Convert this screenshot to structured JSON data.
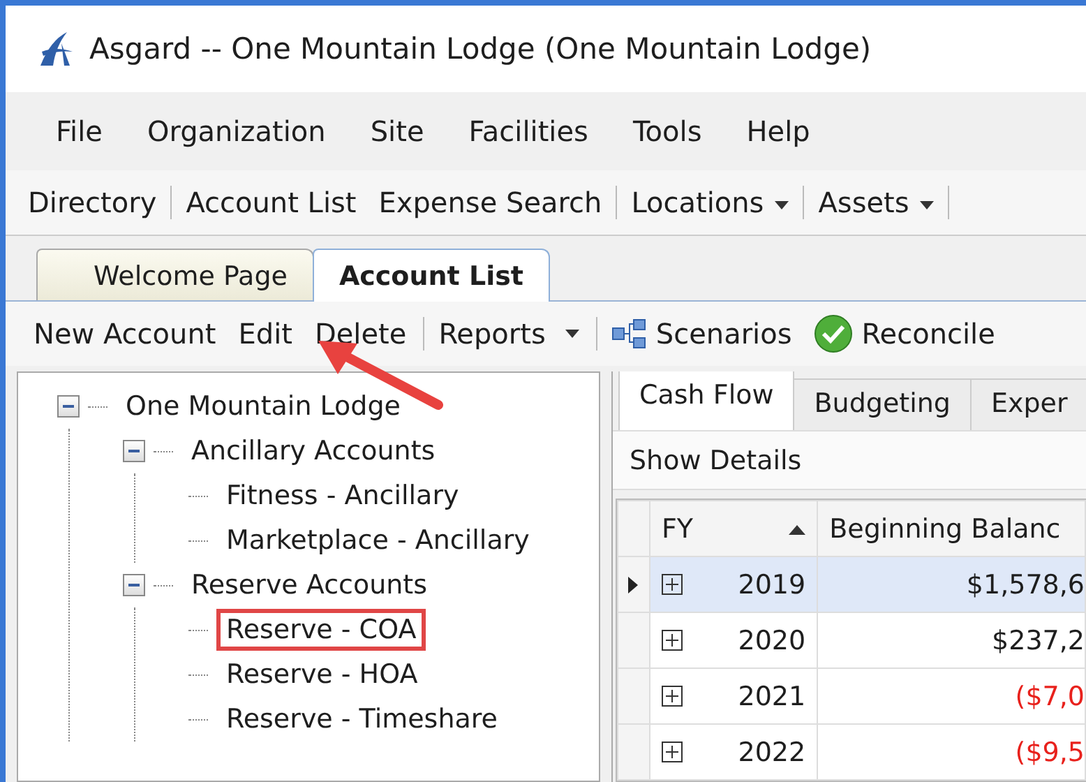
{
  "window": {
    "title": "Asgard -- One Mountain Lodge (One Mountain Lodge)"
  },
  "menu": [
    "File",
    "Organization",
    "Site",
    "Facilities",
    "Tools",
    "Help"
  ],
  "toolbar": [
    {
      "label": "Directory",
      "dropdown": false,
      "separator_after": true
    },
    {
      "label": "Account List",
      "dropdown": false,
      "separator_after": false
    },
    {
      "label": "Expense Search",
      "dropdown": false,
      "separator_after": true
    },
    {
      "label": "Locations",
      "dropdown": true,
      "separator_after": true
    },
    {
      "label": "Assets",
      "dropdown": true,
      "separator_after": true
    }
  ],
  "document_tabs": [
    {
      "label": "Welcome Page",
      "selected": false
    },
    {
      "label": "Account List",
      "selected": true
    }
  ],
  "actions": [
    {
      "label": "New Account",
      "kind": "plain",
      "separator_after": false
    },
    {
      "label": "Edit",
      "kind": "plain",
      "separator_after": false
    },
    {
      "label": "Delete",
      "kind": "plain",
      "separator_after": true
    },
    {
      "label": "Reports",
      "kind": "dropdown",
      "separator_after": true
    },
    {
      "label": "Scenarios",
      "kind": "scenarios",
      "separator_after": false
    },
    {
      "label": "Reconcile",
      "kind": "reconcile",
      "separator_after": false
    }
  ],
  "tree": [
    {
      "label": "One Mountain Lodge",
      "expanded": true,
      "highlighted": false,
      "children": [
        {
          "label": "Ancillary Accounts",
          "expanded": true,
          "highlighted": false,
          "children": [
            {
              "label": "Fitness - Ancillary",
              "highlighted": false
            },
            {
              "label": "Marketplace - Ancillary",
              "highlighted": false
            }
          ]
        },
        {
          "label": "Reserve Accounts",
          "expanded": true,
          "highlighted": false,
          "children": [
            {
              "label": "Reserve - COA",
              "highlighted": true
            },
            {
              "label": "Reserve - HOA",
              "highlighted": false
            },
            {
              "label": "Reserve - Timeshare",
              "highlighted": false
            }
          ]
        }
      ]
    }
  ],
  "detail_tabs": [
    {
      "label": "Cash Flow",
      "selected": true
    },
    {
      "label": "Budgeting",
      "selected": false
    },
    {
      "label": "Exper",
      "selected": false
    }
  ],
  "detail_toolbar": "Show Details",
  "grid": {
    "columns": [
      {
        "label": "FY",
        "sorted": true
      },
      {
        "label": "Beginning Balanc",
        "sorted": false
      }
    ],
    "rows": [
      {
        "fy": "2019",
        "beginning_balance": "$1,578,6",
        "negative": false,
        "selected": true
      },
      {
        "fy": "2020",
        "beginning_balance": "$237,2",
        "negative": false,
        "selected": false
      },
      {
        "fy": "2021",
        "beginning_balance": "($7,0",
        "negative": true,
        "selected": false
      },
      {
        "fy": "2022",
        "beginning_balance": "($9,5",
        "negative": true,
        "selected": false
      }
    ]
  }
}
